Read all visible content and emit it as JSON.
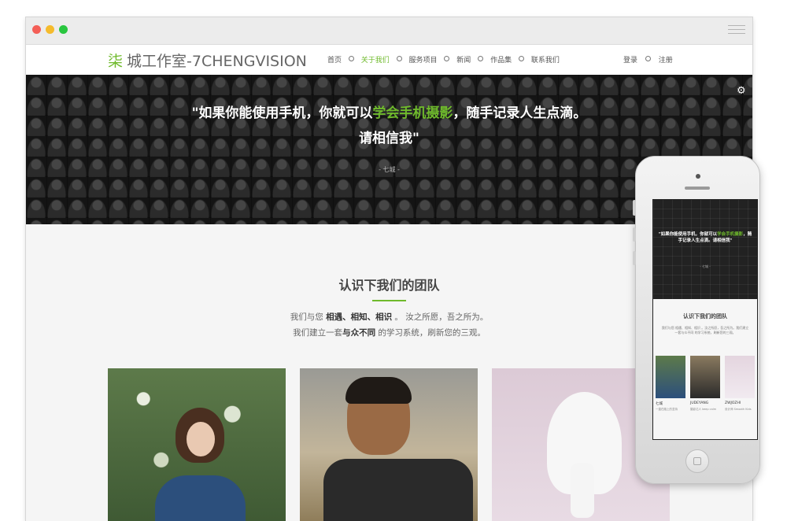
{
  "window": {
    "controls": [
      "close",
      "minimize",
      "maximize"
    ],
    "menu_icon": "hamburger-icon"
  },
  "header": {
    "logo_glyph": "柒",
    "logo_text": "城工作室-7CHENGVISION",
    "nav": [
      {
        "label": "首页",
        "active": false
      },
      {
        "label": "关于我们",
        "active": true
      },
      {
        "label": "服务项目",
        "active": false
      },
      {
        "label": "新闻",
        "active": false
      },
      {
        "label": "作品集",
        "active": false
      },
      {
        "label": "联系我们",
        "active": false
      }
    ],
    "login": "登录",
    "register": "注册"
  },
  "hero": {
    "quote_part1": "\"如果你能使用手机，你就可以",
    "quote_highlight": "学会手机摄影",
    "quote_part2": "，随手记录人生点滴。",
    "quote_line2": "请相信我\"",
    "author": "- 七城 -",
    "settings_icon": "gears-icon"
  },
  "team": {
    "title": "认识下我们的团队",
    "desc1_pre": "我们与您 ",
    "desc1_bold": "相遇、相知、相识",
    "desc1_post": " 。 汝之所愿，吾之所为。",
    "desc2_pre": "我们建立一套",
    "desc2_bold": "与众不同",
    "desc2_post": " 的学习系统，刷新您的三观。"
  },
  "mobile": {
    "quote_part1": "\"如果你能使用手机，你就可以",
    "quote_highlight": "学会手机摄影",
    "quote_part2": "，随手记录人生点滴。请相信我\"",
    "author": "- 七城 -",
    "title": "认识下我们的团队",
    "desc": "我们与您 相遇、相知、相识 。汝之所愿，吾之所为。我们建立一套与众不同 的学习系统，刷新您的三观。",
    "members": [
      {
        "name": "七城",
        "caption": "一直在路上的坚持"
      },
      {
        "name": "JUDEYANG",
        "caption": "摄影达人 keep calm"
      },
      {
        "name": "ZWJOZHI",
        "caption": "设计师 Smooth Kids"
      }
    ]
  },
  "colors": {
    "accent": "#6fba2c",
    "hero_bg": "#1f1f1f",
    "content_bg": "#f5f5f5"
  }
}
